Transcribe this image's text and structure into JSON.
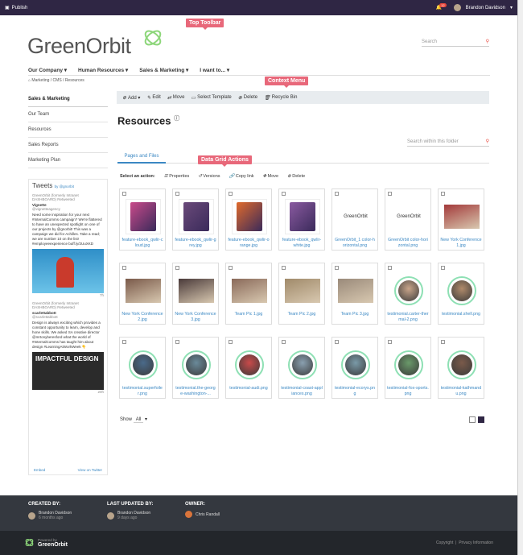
{
  "topbar": {
    "publish": "Publish",
    "notif_count": "12",
    "user": "Brandon Davidson"
  },
  "annotations": {
    "top_toolbar": "Top Toolbar",
    "context_menu": "Context Menu",
    "data_grid_actions": "Data Grid Actions"
  },
  "header": {
    "logo": "GreenOrbit",
    "search_placeholder": "Search"
  },
  "nav": [
    "Our Company ▾",
    "Human Resources ▾",
    "Sales & Marketing ▾",
    "I want to... ▾"
  ],
  "breadcrumb": "Marketing  /  CMS  /  Resources",
  "sidebar": [
    "Sales & Marketing",
    "Our Team",
    "Resources",
    "Sales Reports",
    "Marketing Plan"
  ],
  "tweets": {
    "title": "Tweets",
    "by": "by @gnorbit",
    "retweet1": "GreenOrbit (formerly Intranet DASHBOARD) Retweeted",
    "author1": "Vignette",
    "handle1": "@vignetteagency",
    "text1": "Need some inspiration for your next #InternalComms campaign? We're flattered to have an unexpected spotlight on one of our projects by @gnorbit! This was a campaign we did for Achilles. Take a read; we are number 10 on the list! #employeeexperience buff.ly/2UuXKD",
    "time1": "7h",
    "retweet2": "GreenOrbit (formerly Intranet DASHBOARD) Retweeted",
    "author2": "scarlettabbott",
    "handle2": "@scarlettabbott",
    "text2": "Design is always exciting which provides a constant opportunity to learn, develop and hone skills. We asked SA creative director @mrtonyberesford what the world of #InternalComms has taught him about design #LearningAtWorkWeek 👇",
    "img2": "IMPACTFUL DESIGN",
    "time2": "20h",
    "embed": "Embed",
    "view": "View on Twitter"
  },
  "toolbar": [
    "Add ▾",
    "Edit",
    "Move",
    "Select Template",
    "Delete",
    "Recycle Bin"
  ],
  "main": {
    "title": "Resources",
    "folder_search": "Search within this folder",
    "tab": "Pages and Files",
    "select_action": "Select an action:",
    "actions": [
      "Properties",
      "Versions",
      "Copy link",
      "Move",
      "Delete"
    ],
    "show": "Show",
    "show_value": "All"
  },
  "files": [
    {
      "name": "feature-ebook_qwlir-cloud.jpg",
      "kind": "ebook",
      "color": "#c94a8a"
    },
    {
      "name": "feature-ebook_qwlir-grey.jpg",
      "kind": "ebook",
      "color": "#6a4a7a"
    },
    {
      "name": "feature-ebook_qwlir-orange.jpg",
      "kind": "ebook",
      "color": "#e06a2c"
    },
    {
      "name": "feature-ebook_qwlir-white.jpg",
      "kind": "ebook",
      "color": "#8a5aa0"
    },
    {
      "name": "GreenOrbit_1 color-horizontal.png",
      "kind": "logo",
      "color": "#fff"
    },
    {
      "name": "GreenOrbit color-horizontal.png",
      "kind": "logo",
      "color": "#fff"
    },
    {
      "name": "New York Conference 1.jpg",
      "kind": "photo",
      "color": "#a33a3a"
    },
    {
      "name": "New York Conference 2.jpg",
      "kind": "photo",
      "color": "#7a5a4a"
    },
    {
      "name": "New York Conference 3.jpg",
      "kind": "photo",
      "color": "#4a3a3a"
    },
    {
      "name": "Team Pic 1.jpg",
      "kind": "photo",
      "color": "#8a6a5a"
    },
    {
      "name": "Team Pic 2.jpg",
      "kind": "photo",
      "color": "#a08a6a"
    },
    {
      "name": "Team Pic 3.jpg",
      "kind": "photo",
      "color": "#9a8a7a"
    },
    {
      "name": "testimonial.carter-thermal-2.png",
      "kind": "ring",
      "color": "#c9a58a"
    },
    {
      "name": "testimonial.shell.png",
      "kind": "ring",
      "color": "#b08a6a"
    },
    {
      "name": "testimonial.superfoiler.png",
      "kind": "ring",
      "color": "#4a6a8a"
    },
    {
      "name": "testimonial.the-george-washington-...",
      "kind": "ring",
      "color": "#6a8a9a"
    },
    {
      "name": "testimonial-audi.png",
      "kind": "ring",
      "color": "#c94a4a"
    },
    {
      "name": "testimonial-coast-appliances.png",
      "kind": "ring",
      "color": "#8aa0b0"
    },
    {
      "name": "testimonial-ecorys.png",
      "kind": "ring",
      "color": "#7a9aa8"
    },
    {
      "name": "testimonial-fox-sports.png",
      "kind": "ring",
      "color": "#6a9a6a"
    },
    {
      "name": "testimonial-kathmandu.png",
      "kind": "ring",
      "color": "#7a5a4a"
    }
  ],
  "footer": {
    "created_label": "CREATED BY:",
    "created_name": "Brandon Davidson",
    "created_time": "6 months ago",
    "updated_label": "LAST UPDATED BY:",
    "updated_name": "Brandon Davidson",
    "updated_time": "9 days ago",
    "owner_label": "OWNER:",
    "owner_name": "Chris Randall",
    "powered": "Powered by",
    "brand": "GreenOrbit",
    "copyright": "Copyright",
    "privacy": "Privacy Information"
  }
}
